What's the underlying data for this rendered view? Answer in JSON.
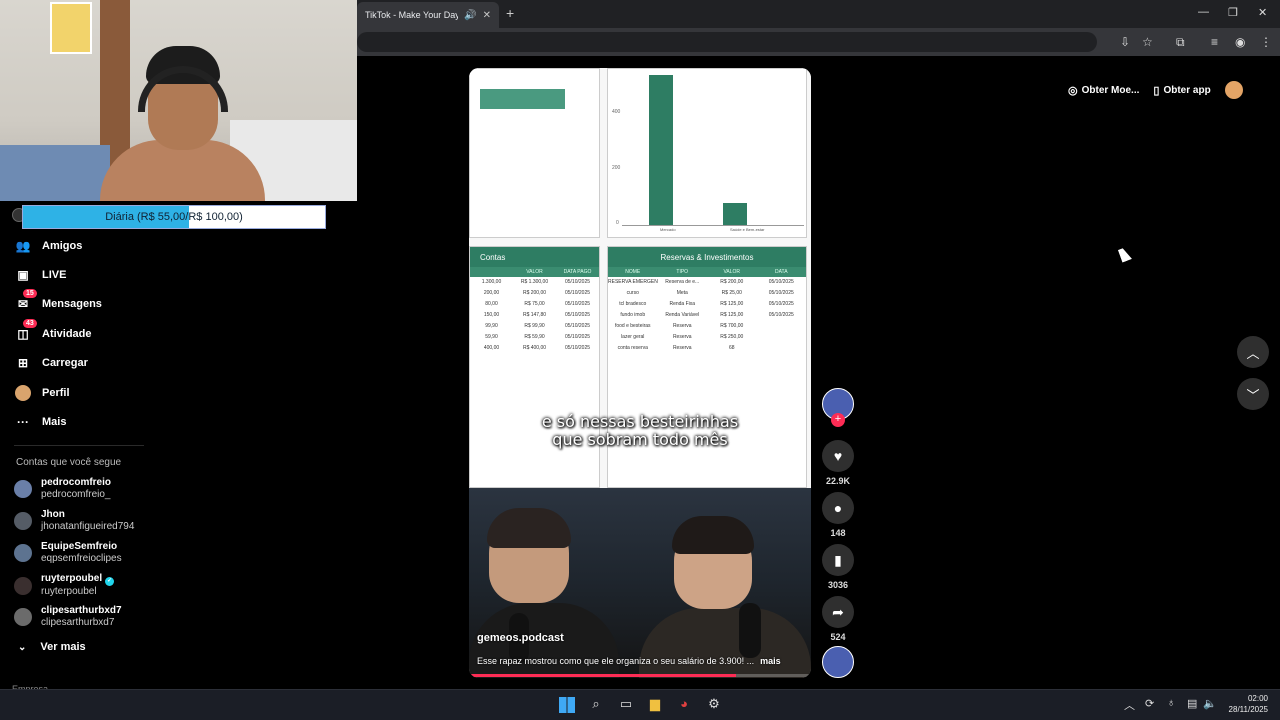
{
  "browser": {
    "tab_title": "TikTok - Make Your Day",
    "tab_audio_icon": "speaker-icon",
    "tab_close": "✕",
    "new_tab": "+",
    "window_controls": [
      "—",
      "❐",
      "✕"
    ]
  },
  "stream_goal": {
    "label": "Diária (R$ 55,00/R$ 100,00)",
    "progress": 0.55
  },
  "sidebar": {
    "items": [
      {
        "label": "Amigos",
        "icon": "friends-icon",
        "glyph": "👥"
      },
      {
        "label": "LIVE",
        "icon": "live-icon",
        "glyph": "▣"
      },
      {
        "label": "Mensagens",
        "icon": "messages-icon",
        "glyph": "✉",
        "badge": "15"
      },
      {
        "label": "Atividade",
        "icon": "activity-icon",
        "glyph": "◫",
        "badge": "43"
      },
      {
        "label": "Carregar",
        "icon": "upload-icon",
        "glyph": "⊞"
      },
      {
        "label": "Perfil",
        "icon": "profile-avatar-icon",
        "glyph": ""
      },
      {
        "label": "Mais",
        "icon": "more-icon",
        "glyph": "···"
      }
    ],
    "following_title": "Contas que você segue",
    "following": [
      {
        "name": "pedrocomfreio",
        "handle": "pedrocomfreio_",
        "verified": false,
        "color": "#6a7fa8"
      },
      {
        "name": "Jhon",
        "handle": "jhonatanfigueired794",
        "verified": false,
        "color": "#555c66"
      },
      {
        "name": "EquipeSemfreio",
        "handle": "eqpsemfreioclipes",
        "verified": false,
        "color": "#5d7390"
      },
      {
        "name": "ruyterpoubel",
        "handle": "ruyterpoubel",
        "verified": true,
        "color": "#3a2f2f"
      },
      {
        "name": "clipesarthurbxd7",
        "handle": "clipesarthurbxd7",
        "verified": false,
        "color": "#6b6b6b"
      }
    ],
    "see_more": "Ver mais",
    "footer": "Empresa"
  },
  "video": {
    "caption_line1": "e só nessas besteirinhas",
    "caption_line2": "que sobram todo mês",
    "author": "gemeos.podcast",
    "description": "Esse rapaz mostrou como que ele organiza o seu salário de 3.900! ...",
    "more": "mais",
    "progress": 0.78,
    "sheet": {
      "left_title": "Contas",
      "right_title": "Reservas & Investimentos",
      "left_cols": [
        "VALOR",
        "DATA PAGO"
      ],
      "right_cols": [
        "NOME",
        "TIPO",
        "VALOR",
        "DATA"
      ],
      "left_rows": [
        [
          "1.300,00",
          "R$ 1.300,00",
          "05/10/2025"
        ],
        [
          "200,00",
          "R$ 200,00",
          "05/10/2025"
        ],
        [
          "80,00",
          "R$ 75,00",
          "05/10/2025"
        ],
        [
          "150,00",
          "R$ 147,80",
          "05/10/2025"
        ],
        [
          "99,90",
          "R$ 99,90",
          "05/10/2025"
        ],
        [
          "59,90",
          "R$ 59,90",
          "05/10/2025"
        ],
        [
          "400,00",
          "R$ 400,00",
          "05/10/2025"
        ]
      ],
      "right_rows": [
        [
          "RESERVA EMERGEN",
          "Reserva de e...",
          "R$ 200,00",
          "05/10/2025"
        ],
        [
          "curso",
          "Meta",
          "R$ 25,00",
          "05/10/2025"
        ],
        [
          "tcl bradesco",
          "Renda Fixa",
          "R$ 125,00",
          "05/10/2025"
        ],
        [
          "fundo imob",
          "Renda Variável",
          "R$ 125,00",
          "05/10/2025"
        ],
        [
          "food e besteiras",
          "Reserva",
          "R$ 700,00",
          ""
        ],
        [
          "lazer geral",
          "Reserva",
          "R$ 250,00",
          ""
        ],
        [
          "conta reserva",
          "Reserva",
          "68",
          ""
        ]
      ],
      "chart_ticks": [
        "400",
        "200",
        "0"
      ],
      "chart_legend": [
        "Mercado",
        "Saúde e Bem-estar"
      ]
    }
  },
  "actions": {
    "likes": "22.9K",
    "comments": "148",
    "saves": "3036",
    "shares": "524"
  },
  "topbar": {
    "coins": "Obter Moe...",
    "app": "Obter app"
  },
  "taskbar": {
    "time": "02:00",
    "date": "28/11/2025"
  }
}
